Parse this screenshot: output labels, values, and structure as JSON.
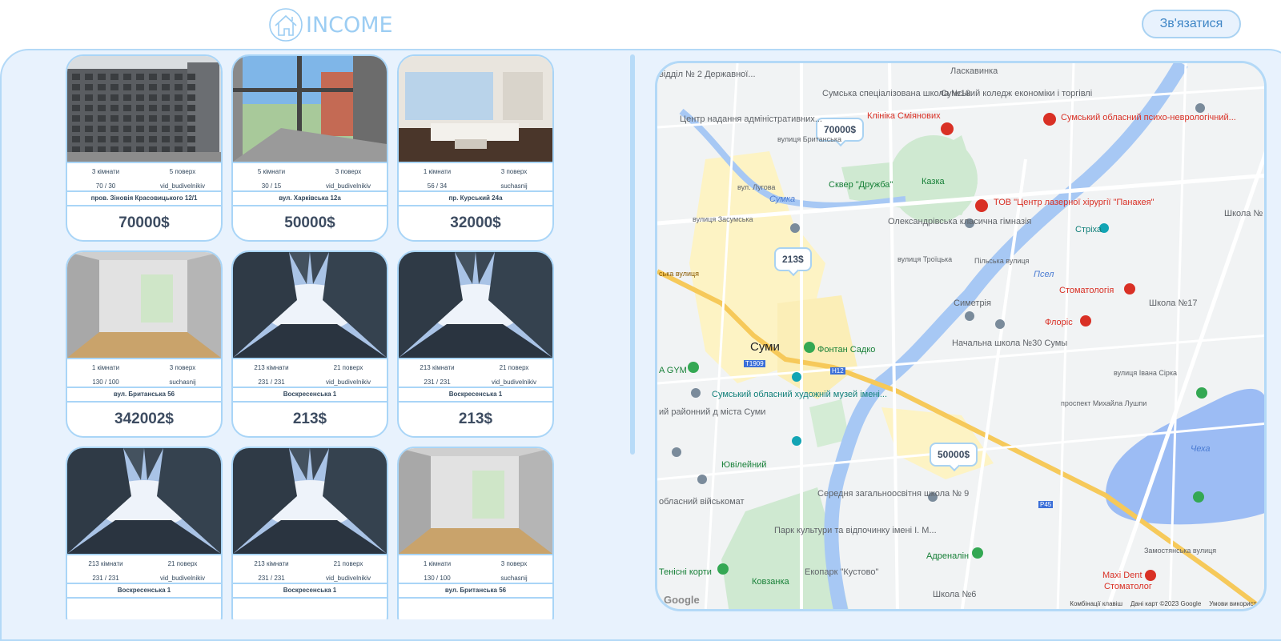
{
  "header": {
    "logo_text": "INCOME",
    "contact_label": "Зв'язатися"
  },
  "listings": [
    {
      "rooms": "3 кімнати",
      "floor": "5 поверх",
      "area": "70 / 30",
      "style": "vid_budivelnikiv",
      "address": "пров. Зіновія Красовицького 12/1",
      "price": "70000$",
      "photo": "building-exterior"
    },
    {
      "rooms": "5 кімнати",
      "floor": "3 поверх",
      "area": "30 / 15",
      "style": "vid_budivelnikiv",
      "address": "вул. Харківська 12а",
      "price": "50000$",
      "photo": "window-view"
    },
    {
      "rooms": "1 кімнати",
      "floor": "3 поверх",
      "area": "56 / 34",
      "style": "suchasnij",
      "address": "пр. Курський 24а",
      "price": "32000$",
      "photo": "living-room"
    },
    {
      "rooms": "1 кімнати",
      "floor": "3 поверх",
      "area": "130 / 100",
      "style": "suchasnij",
      "address": "вул. Британська 56",
      "price": "342002$",
      "photo": "empty-room"
    },
    {
      "rooms": "213 кімнати",
      "floor": "21 поверх",
      "area": "231 / 231",
      "style": "vid_budivelnikiv",
      "address": "Воскресенська 1",
      "price": "213$",
      "photo": "skyscrapers"
    },
    {
      "rooms": "213 кімнати",
      "floor": "21 поверх",
      "area": "231 / 231",
      "style": "vid_budivelnikiv",
      "address": "Воскресенська 1",
      "price": "213$",
      "photo": "skyscrapers"
    },
    {
      "rooms": "213 кімнати",
      "floor": "21 поверх",
      "area": "231 / 231",
      "style": "vid_budivelnikiv",
      "address": "Воскресенська 1",
      "price": "",
      "photo": "skyscrapers"
    },
    {
      "rooms": "213 кімнати",
      "floor": "21 поверх",
      "area": "231 / 231",
      "style": "vid_budivelnikiv",
      "address": "Воскресенська 1",
      "price": "",
      "photo": "skyscrapers"
    },
    {
      "rooms": "1 кімнати",
      "floor": "3 поверх",
      "area": "130 / 100",
      "style": "suchasnij",
      "address": "вул. Британська 56",
      "price": "",
      "photo": "empty-room"
    }
  ],
  "map": {
    "markers": [
      "70000$",
      "213$",
      "50000$"
    ],
    "labels": {
      "city": "Суми",
      "poi1": "Сумська спеціалізована школа №10",
      "poi2": "Сумський коледж економіки і торгівлі",
      "poi3": "Ласкавинка",
      "poi4": "Клініка Сміянових",
      "poi5": "Сумський обласний психо-неврологічний...",
      "poi6": "Центр надання адміністративних...",
      "poi7": "Сквер \"Дружба\"",
      "poi8": "Казка",
      "poi9": "ТОВ \"Центр лазерної хірургії \"Панакея\"",
      "poi10": "Олександрівська класична гімназія",
      "poi11": "Стріха",
      "poi12": "Стоматологія",
      "poi13": "Симетрія",
      "poi14": "Флоріс",
      "poi15": "Школа №17",
      "poi16": "Начальна школа №30 Сумы",
      "poi17": "Фонтан Садко",
      "poi18": "Сумський обласний художній музей імені...",
      "poi19": "Ювілейний",
      "poi20": "Середня загальноосвітня школа № 9",
      "poi21": "Парк культури та відпочинку імені І. М...",
      "poi22": "Адреналін",
      "poi23": "Maxi Dent",
      "poi24": "Стоматолог",
      "poi25": "Екопарк \"Кустово\"",
      "poi26": "Ковзанка",
      "poi27": "Тенісні корти",
      "poi28": "обласний військомат",
      "poi29": "ий районний д міста Суми",
      "poi30": "A GYM",
      "poi31": "Школа №",
      "poi32": "Школа №6",
      "poi33": "відділ № 2 Державної...",
      "river1": "Псел",
      "river2": "Сумка",
      "lake": "Чеха",
      "road1": "вулиця Троїцька",
      "road2": "вулиця Британська",
      "road3": "вулиця Засумська",
      "road4": "проспект Михайла Лушпи",
      "road5": "вулиця Івана Сірка",
      "road6": "Замостянська вулиця",
      "road7": "ська вулиця",
      "road8": "Пільська вулиця",
      "road9": "вул. Лугова",
      "badge1": "Т1909",
      "badge2": "Н12",
      "badge3": "Р45"
    },
    "footer": {
      "keys": "Комбінації клавіш",
      "data": "Дані карт ©2023 Google",
      "terms": "Умови використ..."
    },
    "google": "Google"
  }
}
